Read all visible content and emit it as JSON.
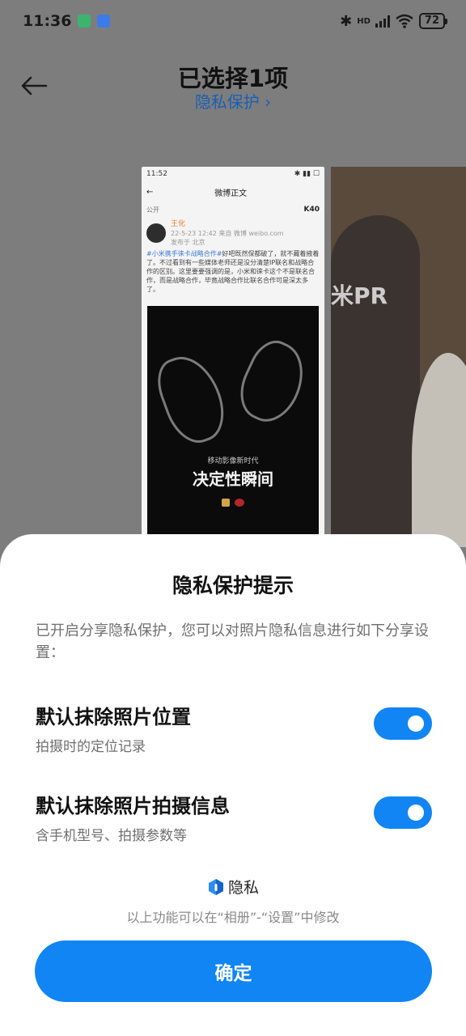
{
  "status_bar": {
    "time": "11:36",
    "network": "HD",
    "battery": "72"
  },
  "header": {
    "title": "已选择1项",
    "privacy_link": "隐私保护 ›"
  },
  "preview": {
    "status_time": "11:52",
    "nav_title": "微博正文",
    "public_label": "公开",
    "k40_label": "K40",
    "user_name": "王化",
    "user_meta": "22-5-23 12:42 来自 微博 weibo.com",
    "user_location": "发布于 北京",
    "body_tag": "#小米携手徕卡战略合作#",
    "body_text": "好吧既然保都破了，就不藏着掖着了。不过看到有一些媒体老师还是没分清楚IP联名和战略合作的区别。这里要要强调的是，小米和徕卡这个不是联名合作，而是战略合作，毕竟战略合作比联名合作可是深太多了。",
    "image_sub": "移动影像新时代",
    "image_title": "决定性瞬间",
    "second_text": "米PR"
  },
  "sheet": {
    "title": "隐私保护提示",
    "description": "已开启分享隐私保护，您可以对照片隐私信息进行如下分享设置：",
    "options": [
      {
        "title": "默认抹除照片位置",
        "subtitle": "拍摄时的定位记录",
        "enabled": true
      },
      {
        "title": "默认抹除照片拍摄信息",
        "subtitle": "含手机型号、拍摄参数等",
        "enabled": true
      }
    ],
    "brand_label": "隐私",
    "footer_hint": "以上功能可以在“相册”-“设置”中修改",
    "confirm_label": "确定"
  },
  "colors": {
    "accent": "#1185f3",
    "link": "#1a5fb4"
  }
}
